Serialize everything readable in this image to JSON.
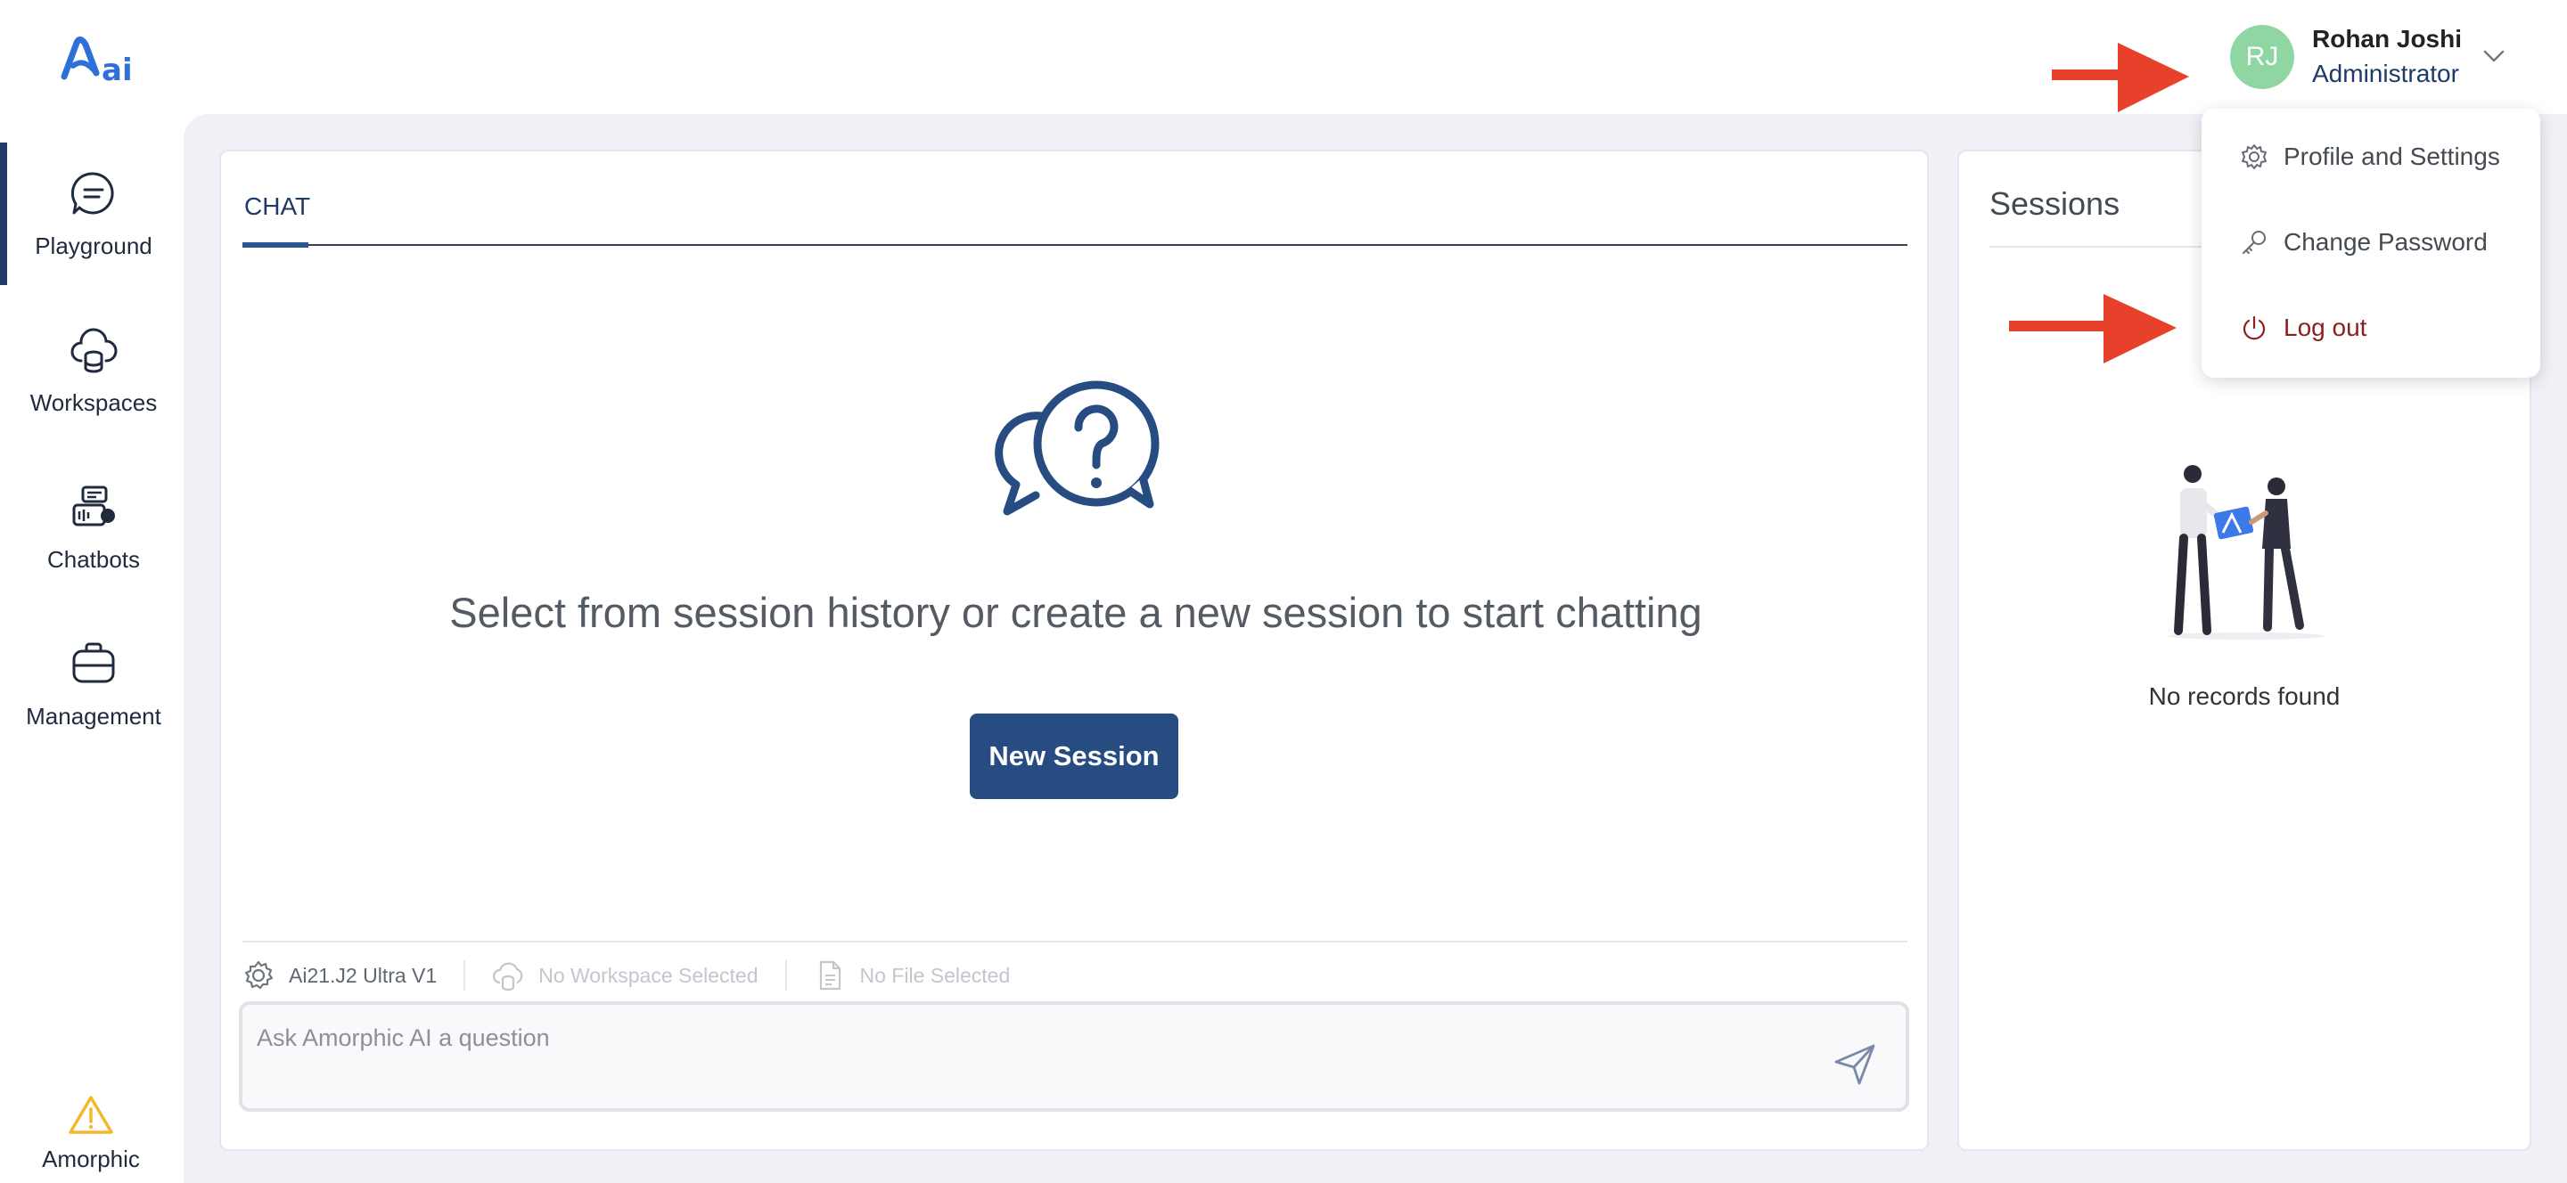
{
  "brand": {
    "logo_icon": "amorphic-ai-logo",
    "footer_label": "Amorphic",
    "footer_icon": "warning-triangle-icon",
    "accent": "#1e3a66",
    "button_color": "#264c82"
  },
  "user": {
    "initials": "RJ",
    "name": "Rohan Joshi",
    "role": "Administrator",
    "avatar_color": "#8fd6a3"
  },
  "user_menu": {
    "items": [
      {
        "label": "Profile and Settings",
        "icon": "gear-icon"
      },
      {
        "label": "Change Password",
        "icon": "key-icon"
      },
      {
        "label": "Log out",
        "icon": "power-icon",
        "color": "#8b1f1f"
      }
    ]
  },
  "sidebar": {
    "items": [
      {
        "label": "Playground",
        "icon": "chat-bubble-icon",
        "active": true
      },
      {
        "label": "Workspaces",
        "icon": "cloud-database-icon",
        "active": false
      },
      {
        "label": "Chatbots",
        "icon": "chatbot-icon",
        "active": false
      },
      {
        "label": "Management",
        "icon": "briefcase-icon",
        "active": false
      }
    ]
  },
  "chat": {
    "tabs": [
      {
        "label": "CHAT",
        "active": true
      }
    ],
    "empty_message": "Select from session history or create a new session to start chatting",
    "new_session_label": "New Session",
    "model": "Ai21.J2 Ultra V1",
    "workspace": "No Workspace Selected",
    "file": "No File Selected",
    "input_placeholder": "Ask Amorphic AI a question"
  },
  "sessions": {
    "title": "Sessions",
    "empty_message": "No records found"
  }
}
